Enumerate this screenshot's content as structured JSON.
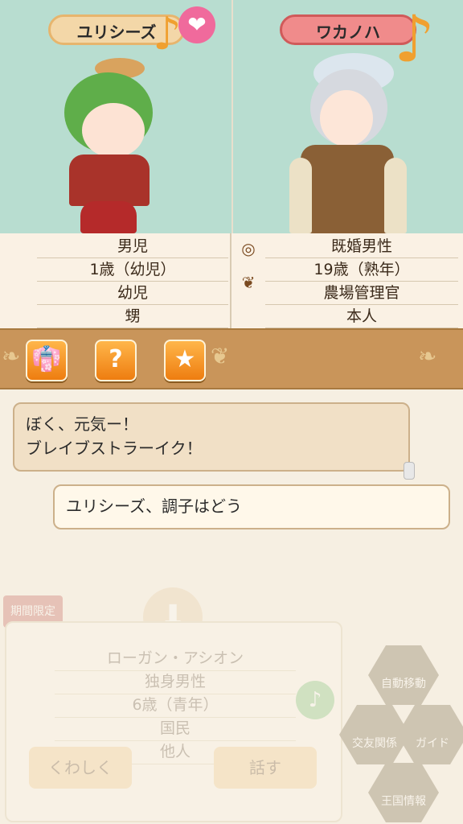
{
  "left_character": {
    "name": "ユリシーズ",
    "details": [
      "男児",
      "1歳（幼児）",
      "幼児",
      "甥"
    ]
  },
  "right_character": {
    "name": "ワカノハ",
    "details": [
      "既婚男性",
      "19歳（熟年）",
      "農場管理官",
      "本人"
    ]
  },
  "icons": {
    "heart": "heart-icon",
    "ring": "ring-icon",
    "wheat": "wheat-icon",
    "music_note": "music-note-icon"
  },
  "action_buttons": [
    {
      "name": "outfit-button",
      "icon": "shirt-icon"
    },
    {
      "name": "help-button",
      "icon": "question-icon"
    },
    {
      "name": "favorite-button",
      "icon": "star-icon"
    }
  ],
  "chat": {
    "npc_line1": "ぼく、元気ー！",
    "npc_line2": "ブレイブストラーイク！",
    "player_line": "ユリシーズ、調子はどう"
  },
  "background_panel": {
    "limited_badge": "期間限定",
    "rows": [
      "ローガン・アシオン",
      "独身男性",
      "6歳（青年）",
      "国民",
      "他人"
    ],
    "details_button": "くわしく",
    "talk_button": "話す",
    "menu": [
      "自動移動",
      "交友関係",
      "ガイド",
      "王国情報"
    ]
  },
  "colors": {
    "portrait_bg": "#b8ddd0",
    "accent_orange": "#ee7d10",
    "heart_pink": "#f06a9c"
  }
}
